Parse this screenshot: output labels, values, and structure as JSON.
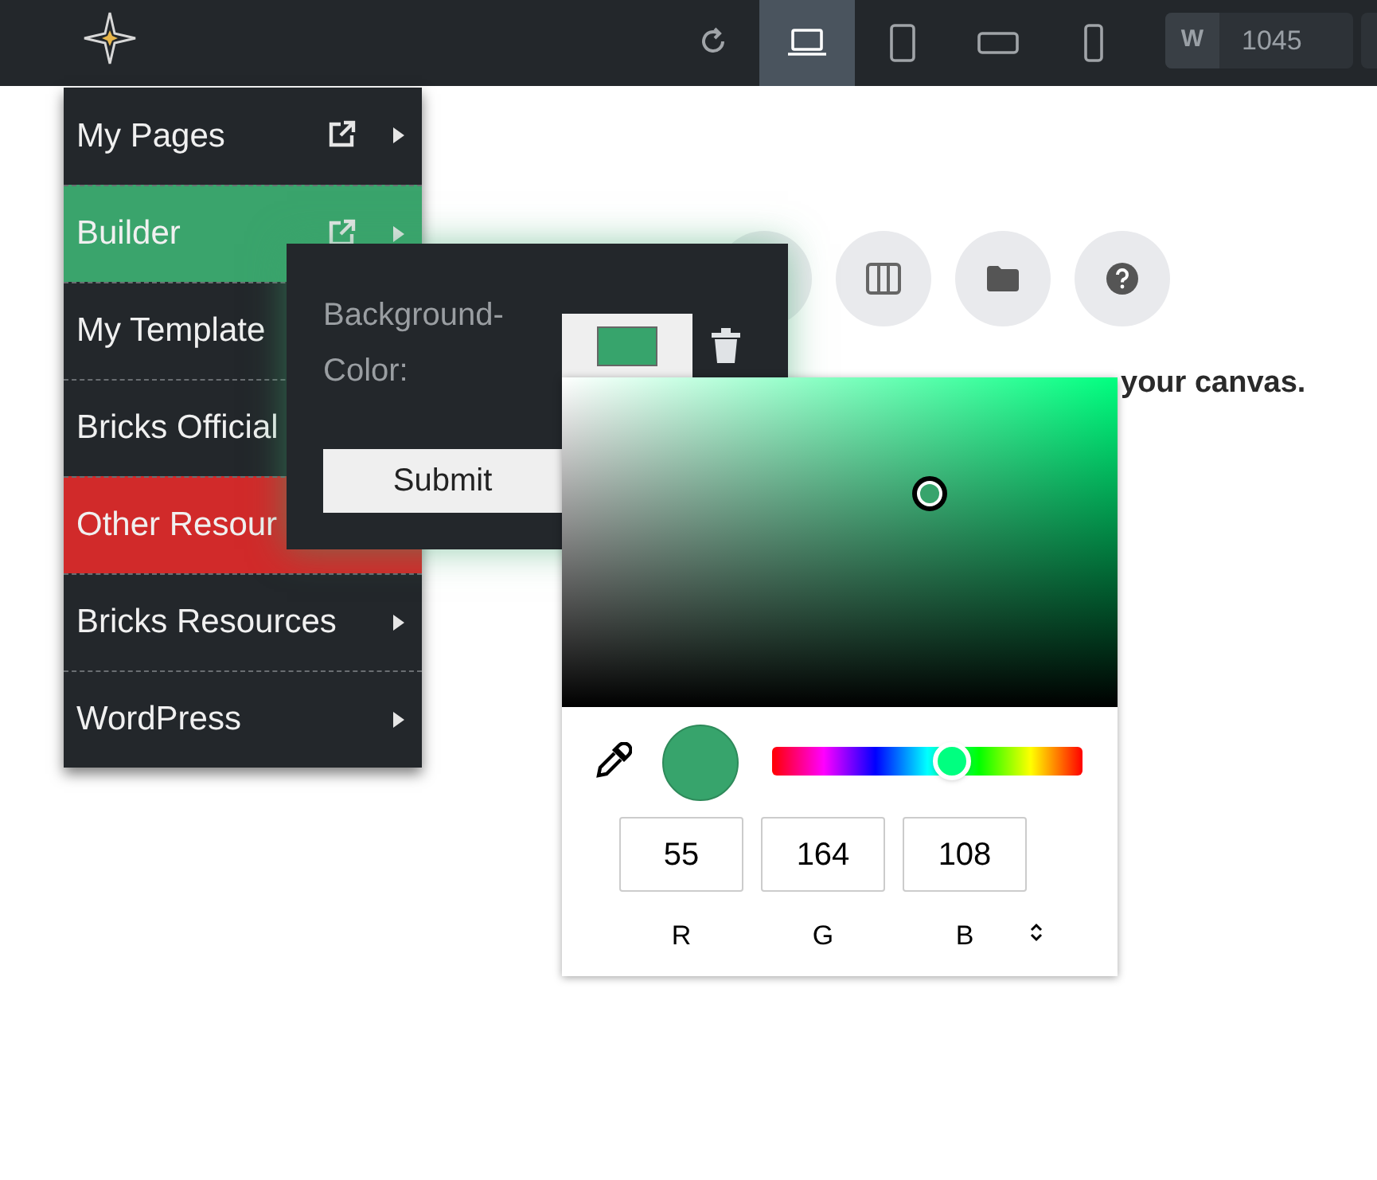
{
  "toolbar": {
    "devices": [
      {
        "kind": "laptop",
        "selected": true
      },
      {
        "kind": "tablet",
        "selected": false
      },
      {
        "kind": "landscape",
        "selected": false
      },
      {
        "kind": "phone",
        "selected": false
      }
    ],
    "width_label": "W",
    "width_value": "1045"
  },
  "menu": [
    {
      "label": "My Pages",
      "external": true,
      "submenu": true,
      "color": "#23272b"
    },
    {
      "label": "Builder",
      "external": true,
      "submenu": true,
      "color": "#3aa46c"
    },
    {
      "label": "My Template",
      "color": "#23272b"
    },
    {
      "label": "Bricks Official",
      "color": "#23272b"
    },
    {
      "label": "Other Resour",
      "color": "#d12a2a"
    },
    {
      "label": "Bricks Resources",
      "external": false,
      "submenu": true,
      "color": "#23272b"
    },
    {
      "label": "WordPress",
      "external": false,
      "submenu": true,
      "color": "#23272b"
    }
  ],
  "canvas": {
    "hint": "your canvas."
  },
  "popover": {
    "label": "Background-Color:",
    "submit": "Submit"
  },
  "picker": {
    "hue": {
      "level": 0.58
    },
    "channels": [
      {
        "value": "55",
        "label": "R"
      },
      {
        "value": "164",
        "label": "G"
      },
      {
        "value": "108",
        "label": "B"
      }
    ]
  }
}
